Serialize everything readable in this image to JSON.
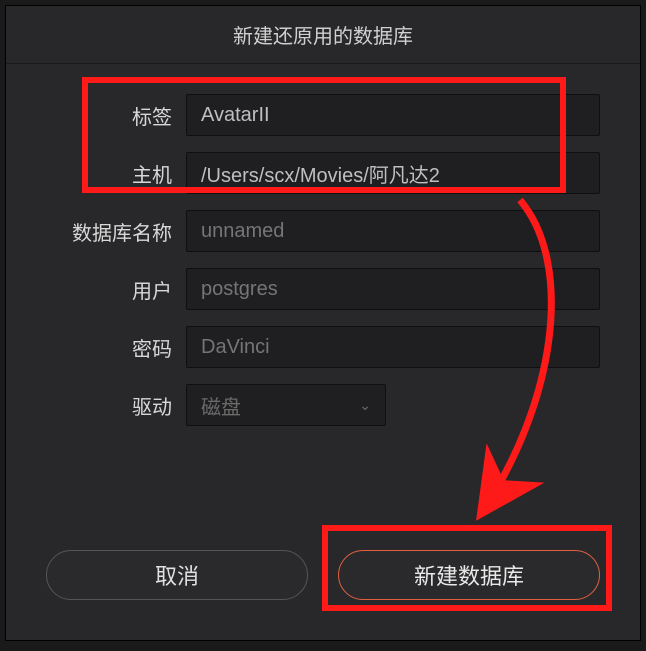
{
  "dialog": {
    "title": "新建还原用的数据库"
  },
  "fields": {
    "tag_label": "标签",
    "tag_value": "AvatarII",
    "host_label": "主机",
    "host_value": "/Users/scx/Movies/阿凡达2",
    "dbname_label": "数据库名称",
    "dbname_placeholder": "unnamed",
    "user_label": "用户",
    "user_placeholder": "postgres",
    "password_label": "密码",
    "password_placeholder": "DaVinci",
    "driver_label": "驱动",
    "driver_value": "磁盘"
  },
  "buttons": {
    "cancel": "取消",
    "create": "新建数据库"
  }
}
